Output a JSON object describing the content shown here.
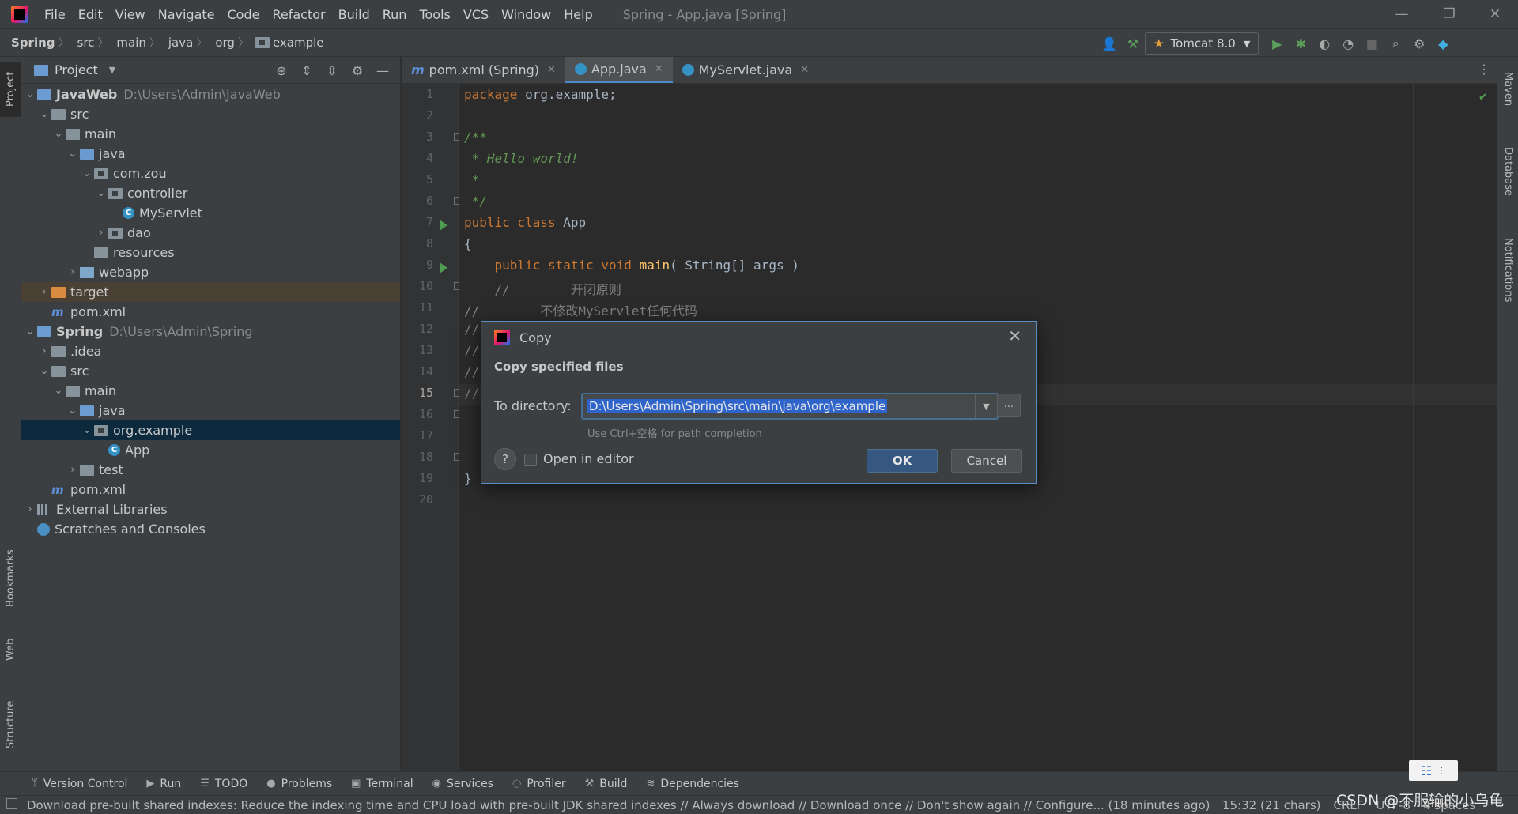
{
  "window": {
    "title": "Spring - App.java [Spring]",
    "menu": [
      "File",
      "Edit",
      "View",
      "Navigate",
      "Code",
      "Refactor",
      "Build",
      "Run",
      "Tools",
      "VCS",
      "Window",
      "Help"
    ],
    "minimize": "—",
    "restore": "❐",
    "close": "✕"
  },
  "breadcrumb": [
    "Spring",
    "src",
    "main",
    "java",
    "org",
    "example"
  ],
  "toolbar": {
    "run_config": "Tomcat 8.0"
  },
  "left_stripe": {
    "project": "Project",
    "bookmarks": "Bookmarks",
    "web": "Web",
    "structure": "Structure"
  },
  "right_stripe": {
    "maven": "Maven",
    "database": "Database",
    "notifications": "Notifications"
  },
  "project_panel": {
    "title": "Project",
    "tree": [
      {
        "label": "JavaWeb",
        "path": "D:\\Users\\Admin\\JavaWeb"
      },
      {
        "label": "src"
      },
      {
        "label": "main"
      },
      {
        "label": "java"
      },
      {
        "label": "com.zou"
      },
      {
        "label": "controller"
      },
      {
        "label": "MyServlet"
      },
      {
        "label": "dao"
      },
      {
        "label": "resources"
      },
      {
        "label": "webapp"
      },
      {
        "label": "target"
      },
      {
        "label": "pom.xml"
      },
      {
        "label": "Spring",
        "path": "D:\\Users\\Admin\\Spring"
      },
      {
        "label": ".idea"
      },
      {
        "label": "src"
      },
      {
        "label": "main"
      },
      {
        "label": "java"
      },
      {
        "label": "org.example"
      },
      {
        "label": "App"
      },
      {
        "label": "test"
      },
      {
        "label": "pom.xml"
      },
      {
        "label": "External Libraries"
      },
      {
        "label": "Scratches and Consoles"
      }
    ]
  },
  "editor": {
    "tabs": [
      {
        "label": "pom.xml (Spring)"
      },
      {
        "label": "App.java"
      },
      {
        "label": "MyServlet.java"
      }
    ],
    "line_numbers": [
      "1",
      "2",
      "3",
      "4",
      "5",
      "6",
      "7",
      "8",
      "9",
      "10",
      "11",
      "12",
      "13",
      "14",
      "15",
      "16",
      "17",
      "18",
      "19",
      "20"
    ],
    "code": {
      "l1_kw": "package",
      "l1_rest": " org.example;",
      "l3": "/**",
      "l4": " * Hello world!",
      "l5": " *",
      "l6": " */",
      "l7_kw": "public class",
      "l7_rest": " App",
      "l8": "{",
      "l9_indent": "    ",
      "l9_kw": "public static void",
      "l9_fn": "main",
      "l9_rest": "( String[] args )",
      "l10": "    //        开闭原则",
      "l11": "//        不修改MyServlet任何代码",
      "l12": "//",
      "l13": "//",
      "l14": "//",
      "l15": "//",
      "l19": "}"
    }
  },
  "dialog": {
    "title": "Copy",
    "heading": "Copy specified files",
    "directory_label": "To directory:",
    "directory_value": "D:\\Users\\Admin\\Spring\\src\\main\\java\\org\\example",
    "hint": "Use Ctrl+空格 for path completion",
    "browse": "...",
    "help": "?",
    "open_in_editor": "Open in editor",
    "ok": "OK",
    "cancel": "Cancel"
  },
  "bottom_tools": [
    "Version Control",
    "Run",
    "TODO",
    "Problems",
    "Terminal",
    "Services",
    "Profiler",
    "Build",
    "Dependencies"
  ],
  "status": {
    "message": "Download pre-built shared indexes: Reduce the indexing time and CPU load with pre-built JDK shared indexes // Always download // Download once // Don't show again // Configure... (18 minutes ago)",
    "position": "15:32 (21 chars)",
    "line_sep": "CRLF",
    "encoding": "UTF-8",
    "indent": "4 spaces"
  },
  "watermark": "CSDN @不服输的小乌龟"
}
